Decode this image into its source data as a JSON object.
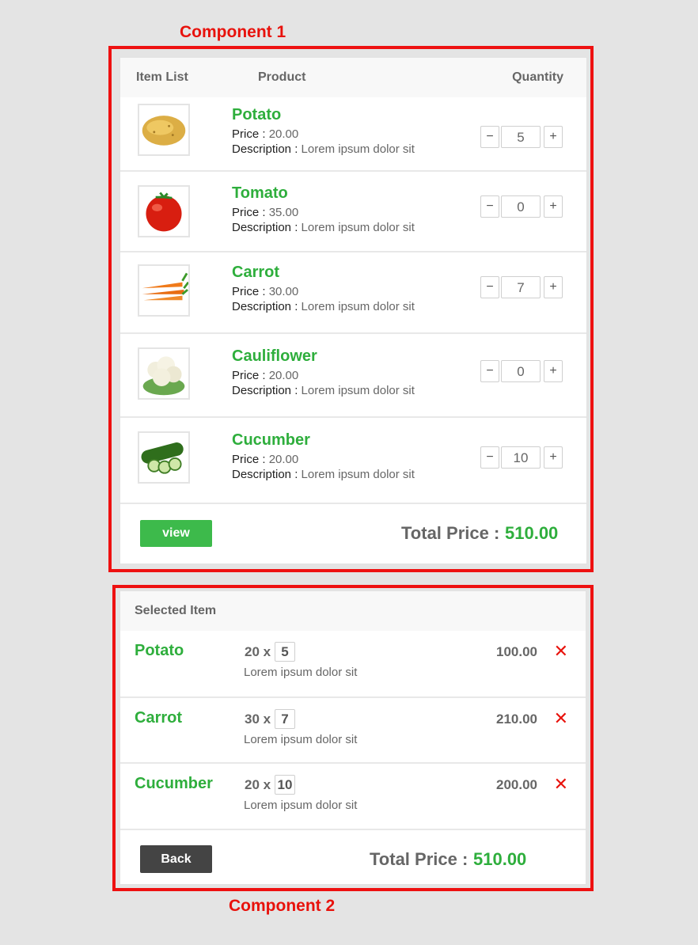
{
  "labels": {
    "component1": "Component 1",
    "component2": "Component 2"
  },
  "product_list": {
    "header": {
      "item_list": "Item List",
      "product": "Product",
      "quantity": "Quantity"
    },
    "price_prefix": "Price : ",
    "description_prefix": "Description : ",
    "minus": "−",
    "plus": "+",
    "items": [
      {
        "name": "Potato",
        "price": "20.00",
        "description": "Lorem ipsum dolor sit",
        "quantity": "5",
        "image": "potato-image"
      },
      {
        "name": "Tomato",
        "price": "35.00",
        "description": "Lorem ipsum dolor sit",
        "quantity": "0",
        "image": "tomato-image"
      },
      {
        "name": "Carrot",
        "price": "30.00",
        "description": "Lorem ipsum dolor sit",
        "quantity": "7",
        "image": "carrot-image"
      },
      {
        "name": "Cauliflower",
        "price": "20.00",
        "description": "Lorem ipsum dolor sit",
        "quantity": "0",
        "image": "cauliflower-image"
      },
      {
        "name": "Cucumber",
        "price": "20.00",
        "description": "Lorem ipsum dolor sit",
        "quantity": "10",
        "image": "cucumber-image"
      }
    ],
    "view_label": "view",
    "total_label": "Total Price :",
    "total_value": "510.00"
  },
  "selected": {
    "header": "Selected Item",
    "times": "x",
    "remove_icon": "close-icon",
    "items": [
      {
        "name": "Potato",
        "unit_price": "20",
        "quantity": "5",
        "description": "Lorem ipsum dolor sit",
        "subtotal": "100.00"
      },
      {
        "name": "Carrot",
        "unit_price": "30",
        "quantity": "7",
        "description": "Lorem ipsum dolor sit",
        "subtotal": "210.00"
      },
      {
        "name": "Cucumber",
        "unit_price": "20",
        "quantity": "10",
        "description": "Lorem ipsum dolor sit",
        "subtotal": "200.00"
      }
    ],
    "back_label": "Back",
    "total_label": "Total Price :",
    "total_value": "510.00"
  },
  "colors": {
    "accent_green": "#2eae3c",
    "button_green": "#3dba4b",
    "frame_red": "#ee1111",
    "back_button": "#444444"
  }
}
